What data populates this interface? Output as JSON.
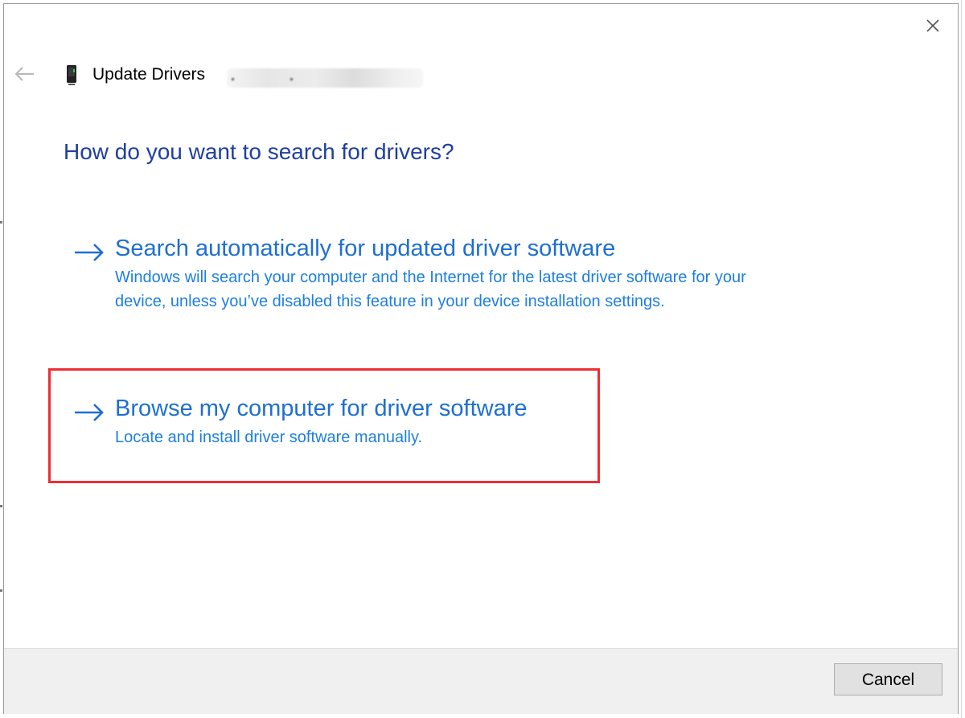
{
  "dialog": {
    "title": "Update Drivers",
    "close_icon": "close-icon",
    "back_icon": "back-arrow-icon",
    "device_icon": "device-icon"
  },
  "heading": "How do you want to search for drivers?",
  "options": [
    {
      "title": "Search automatically for updated driver software",
      "description": "Windows will search your computer and the Internet for the latest driver software for your device, unless you’ve disabled this feature in your device installation settings.",
      "icon": "arrow-right-icon"
    },
    {
      "title": "Browse my computer for driver software",
      "description": "Locate and install driver software manually.",
      "icon": "arrow-right-icon"
    }
  ],
  "footer": {
    "cancel_label": "Cancel"
  },
  "colors": {
    "heading": "#1f3f9e",
    "link": "#1e6fd0",
    "description": "#1d7fe0",
    "highlight": "#ee2d33",
    "footer_bg": "#f0f0f0"
  }
}
